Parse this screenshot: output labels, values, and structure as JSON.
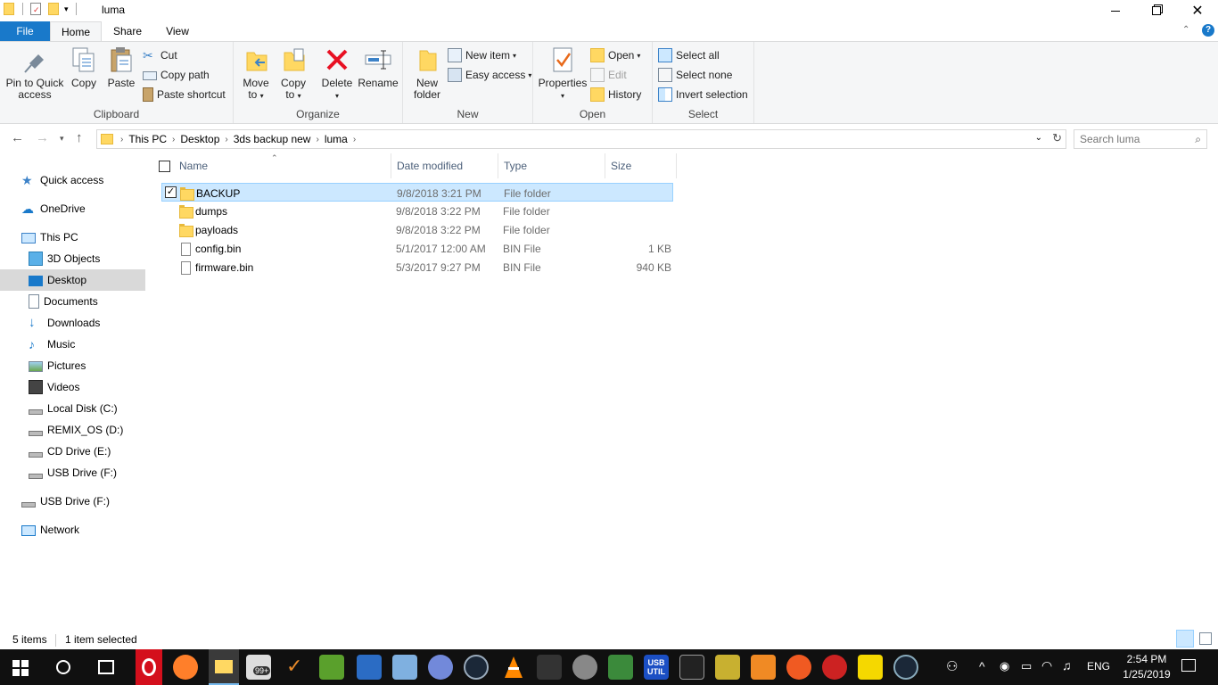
{
  "window": {
    "title": "luma",
    "minimize_icon": "minimize-icon",
    "maximize_icon": "restore-icon",
    "close_icon": "close-icon"
  },
  "tabs": {
    "file": "File",
    "home": "Home",
    "share": "Share",
    "view": "View"
  },
  "ribbon": {
    "clipboard": {
      "label": "Clipboard",
      "pin": "Pin to Quick access",
      "pin_line1": "Pin to Quick",
      "pin_line2": "access",
      "copy": "Copy",
      "paste": "Paste",
      "cut": "Cut",
      "copy_path": "Copy path",
      "paste_shortcut": "Paste shortcut"
    },
    "organize": {
      "label": "Organize",
      "move_line1": "Move",
      "move_line2": "to",
      "copy_line1": "Copy",
      "copy_line2": "to",
      "delete": "Delete",
      "rename": "Rename"
    },
    "new": {
      "label": "New",
      "new_folder_line1": "New",
      "new_folder_line2": "folder",
      "new_item": "New item",
      "easy_access": "Easy access"
    },
    "open": {
      "label": "Open",
      "properties": "Properties",
      "open": "Open",
      "edit": "Edit",
      "history": "History"
    },
    "select": {
      "label": "Select",
      "select_all": "Select all",
      "select_none": "Select none",
      "invert": "Invert selection"
    }
  },
  "address": {
    "crumbs": [
      "This PC",
      "Desktop",
      "3ds backup new",
      "luma"
    ],
    "search_placeholder": "Search luma"
  },
  "nav": {
    "quick_access": "Quick access",
    "onedrive": "OneDrive",
    "this_pc": "This PC",
    "items": [
      "3D Objects",
      "Desktop",
      "Documents",
      "Downloads",
      "Music",
      "Pictures",
      "Videos",
      "Local Disk (C:)",
      "REMIX_OS (D:)",
      "CD Drive (E:)",
      "USB Drive (F:)"
    ],
    "usb": "USB Drive (F:)",
    "network": "Network",
    "selected": "Desktop"
  },
  "columns": {
    "name": "Name",
    "date": "Date modified",
    "type": "Type",
    "size": "Size"
  },
  "files": [
    {
      "name": "BACKUP",
      "date": "9/8/2018 3:21 PM",
      "type": "File folder",
      "size": "",
      "kind": "folder",
      "selected": true
    },
    {
      "name": "dumps",
      "date": "9/8/2018 3:22 PM",
      "type": "File folder",
      "size": "",
      "kind": "folder",
      "selected": false
    },
    {
      "name": "payloads",
      "date": "9/8/2018 3:22 PM",
      "type": "File folder",
      "size": "",
      "kind": "folder",
      "selected": false
    },
    {
      "name": "config.bin",
      "date": "5/1/2017 12:00 AM",
      "type": "BIN File",
      "size": "1 KB",
      "kind": "file",
      "selected": false
    },
    {
      "name": "firmware.bin",
      "date": "5/3/2017 9:27 PM",
      "type": "BIN File",
      "size": "940 KB",
      "kind": "file",
      "selected": false
    }
  ],
  "status": {
    "count": "5 items",
    "selected": "1 item selected"
  },
  "taskbar": {
    "language": "ENG",
    "time": "2:54 PM",
    "date": "1/25/2019",
    "mail_badge": "99+",
    "usb_label": "USB UTIL"
  },
  "colors": {
    "accent": "#1979ca",
    "selection": "#cce8ff",
    "folder": "#ffd862",
    "taskbar": "#101010"
  }
}
